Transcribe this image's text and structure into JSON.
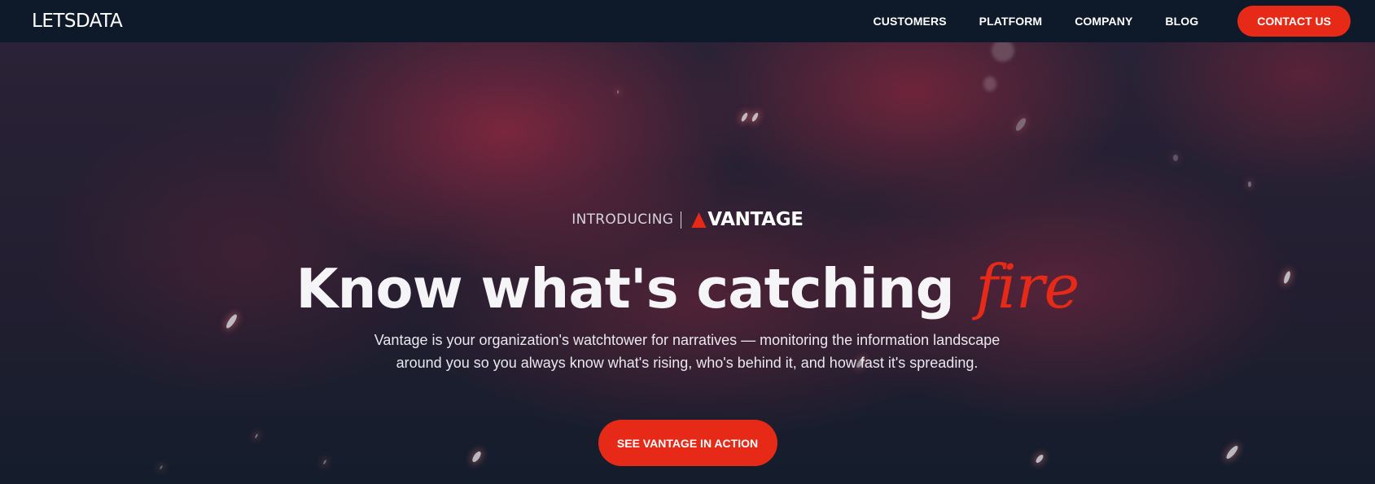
{
  "nav": {
    "logo": "LETSDATA",
    "links": [
      "CUSTOMERS",
      "PLATFORM",
      "COMPANY",
      "BLOG"
    ],
    "contact_label": "CONTACT US"
  },
  "hero": {
    "intro_label": "INTRODUCING",
    "brand_name": "VANTAGE",
    "brand_icon": "vantage-triangle-icon",
    "headline_main": "Know what's catching",
    "headline_accent": "fire",
    "description": "Vantage is your organization's watchtower for narratives — monitoring the information landscape around you so you always know what's rising, who's behind it, and how fast it's spreading.",
    "cta_label": "SEE VANTAGE IN ACTION"
  },
  "colors": {
    "nav_bg": "#0e1a29",
    "accent": "#e62a17",
    "text": "#ffffff"
  }
}
